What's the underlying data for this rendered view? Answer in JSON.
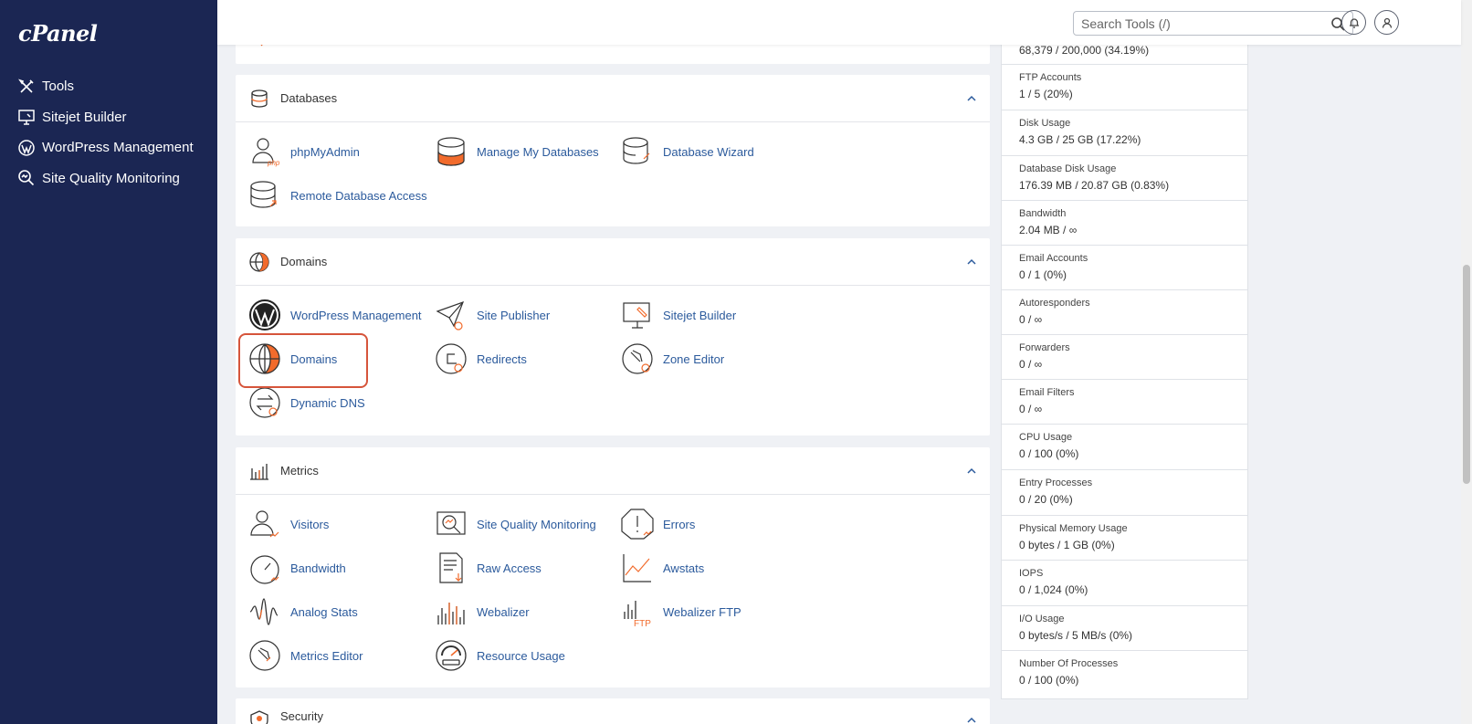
{
  "sidebar": {
    "logo": "cPanel",
    "items": [
      {
        "label": "Tools",
        "icon": "tools-icon"
      },
      {
        "label": "Sitejet Builder",
        "icon": "monitor-icon"
      },
      {
        "label": "WordPress Management",
        "icon": "wordpress-icon"
      },
      {
        "label": "Site Quality Monitoring",
        "icon": "magnifier-icon"
      }
    ]
  },
  "header": {
    "search_placeholder": "Search Tools (/)"
  },
  "sections": {
    "databases": {
      "title": "Databases",
      "items": [
        "phpMyAdmin",
        "Manage My Databases",
        "Database Wizard",
        "Remote Database Access"
      ]
    },
    "domains": {
      "title": "Domains",
      "items": [
        "WordPress Management",
        "Site Publisher",
        "Sitejet Builder",
        "Domains",
        "Redirects",
        "Zone Editor",
        "Dynamic DNS"
      ]
    },
    "metrics": {
      "title": "Metrics",
      "items": [
        "Visitors",
        "Site Quality Monitoring",
        "Errors",
        "Bandwidth",
        "Raw Access",
        "Awstats",
        "Analog Stats",
        "Webalizer",
        "Webalizer FTP",
        "Metrics Editor",
        "Resource Usage"
      ]
    },
    "security": {
      "title": "Security"
    }
  },
  "stats": [
    {
      "label": "",
      "value": "68,379 / 200,000   (34.19%)"
    },
    {
      "label": "FTP Accounts",
      "value": "1 / 5   (20%)"
    },
    {
      "label": "Disk Usage",
      "value": "4.3 GB / 25 GB   (17.22%)"
    },
    {
      "label": "Database Disk Usage",
      "value": "176.39 MB / 20.87 GB   (0.83%)"
    },
    {
      "label": "Bandwidth",
      "value": "2.04 MB / ∞"
    },
    {
      "label": "Email Accounts",
      "value": "0 / 1   (0%)"
    },
    {
      "label": "Autoresponders",
      "value": "0 / ∞"
    },
    {
      "label": "Forwarders",
      "value": "0 / ∞"
    },
    {
      "label": "Email Filters",
      "value": "0 / ∞"
    },
    {
      "label": "CPU Usage",
      "value": "0 / 100   (0%)"
    },
    {
      "label": "Entry Processes",
      "value": "0 / 20   (0%)"
    },
    {
      "label": "Physical Memory Usage",
      "value": "0 bytes / 1 GB   (0%)"
    },
    {
      "label": "IOPS",
      "value": "0 / 1,024   (0%)"
    },
    {
      "label": "I/O Usage",
      "value": "0 bytes/s / 5 MB/s   (0%)"
    },
    {
      "label": "Number Of Processes",
      "value": "0 / 100   (0%)"
    }
  ],
  "colors": {
    "sidebar_bg": "#1b2653",
    "link": "#2b5a9c",
    "accent": "#f26b2c",
    "highlight": "#d6553b"
  }
}
